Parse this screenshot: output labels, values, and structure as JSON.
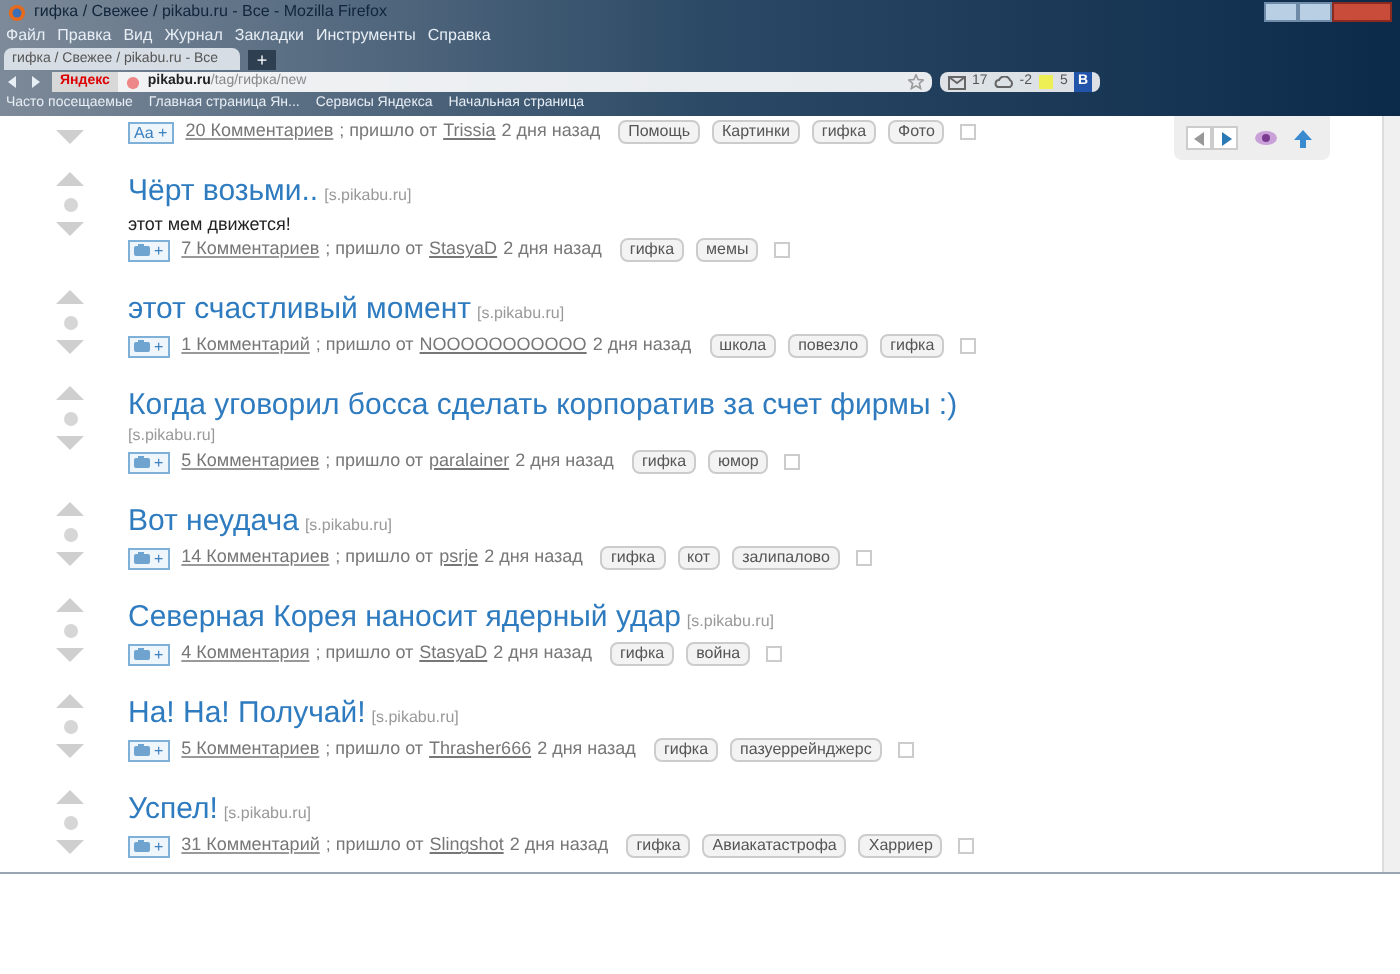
{
  "window": {
    "title": "гифка / Свежее / pikabu.ru - Все - Mozilla Firefox"
  },
  "menu": [
    "Файл",
    "Правка",
    "Вид",
    "Журнал",
    "Закладки",
    "Инструменты",
    "Справка"
  ],
  "tabs": [
    {
      "label": "гифка / Свежее / pikabu.ru - Все",
      "selected": true
    }
  ],
  "new_tab_button": "+",
  "address_bar": {
    "search_engine": "Яндекс",
    "url_host": "pikabu.ru",
    "url_path": "/tag/гифка/new"
  },
  "toolbar": {
    "mail_count": "17",
    "weather": "-2",
    "notes_count": "5",
    "letter": "B"
  },
  "bookmarks": [
    "Часто посещаемые",
    "Главная страница Ян...",
    "Сервисы Яндекса",
    "Начальная страница"
  ],
  "posts": [
    {
      "kind": "meta_only",
      "button": "Aa +",
      "comments": "20 Комментариев",
      "from": "; пришло от",
      "author": "Trissia",
      "time": "2 дня назад",
      "tags": [
        "Помощь",
        "Картинки",
        "гифка",
        "Фото"
      ]
    },
    {
      "kind": "full",
      "title": "Чёрт возьми..",
      "source": "[s.pikabu.ru]",
      "description": "этот мем движется!",
      "button": "+",
      "comments": "7 Комментариев",
      "from": "; пришло от",
      "author": "StasyaD",
      "time": "2 дня назад",
      "tags": [
        "гифка",
        "мемы"
      ]
    },
    {
      "kind": "full",
      "title": "этот счастливый момент",
      "source": "[s.pikabu.ru]",
      "button": "+",
      "comments": "1 Комментарий",
      "from": "; пришло от",
      "author": "NOOOOOOOOOOO",
      "time": "2 дня назад",
      "tags": [
        "школа",
        "повезло",
        "гифка"
      ]
    },
    {
      "kind": "full",
      "title": "Когда уговорил босса сделать корпоратив за счет фирмы :)",
      "source": "[s.pikabu.ru]",
      "source_below": true,
      "button": "+",
      "comments": "5 Комментариев",
      "from": "; пришло от",
      "author": "paralainer",
      "time": "2 дня назад",
      "tags": [
        "гифка",
        "юмор"
      ]
    },
    {
      "kind": "full",
      "title": "Вот неудача",
      "source": "[s.pikabu.ru]",
      "button": "+",
      "comments": "14 Комментариев",
      "from": "; пришло от",
      "author": "psrje",
      "time": "2 дня назад",
      "tags": [
        "гифка",
        "кот",
        "залипалово"
      ]
    },
    {
      "kind": "full",
      "title": "Северная Корея наносит ядерный удар",
      "source": "[s.pikabu.ru]",
      "button": "+",
      "comments": "4 Комментария",
      "from": "; пришло от",
      "author": "StasyaD",
      "time": "2 дня назад",
      "tags": [
        "гифка",
        "война"
      ]
    },
    {
      "kind": "full",
      "title": "На! На! Получай!",
      "source": "[s.pikabu.ru]",
      "button": "+",
      "comments": "5 Комментариев",
      "from": "; пришло от",
      "author": "Thrasher666",
      "time": "2 дня назад",
      "tags": [
        "гифка",
        "пазуеррейнджерс"
      ]
    },
    {
      "kind": "full",
      "title": "Успел!",
      "source": "[s.pikabu.ru]",
      "button": "+",
      "comments": "31 Комментарий",
      "from": "; пришло от",
      "author": "Slingshot",
      "time": "2 дня назад",
      "tags": [
        "гифка",
        "Авиакатастрофа",
        "Харриер"
      ]
    }
  ]
}
